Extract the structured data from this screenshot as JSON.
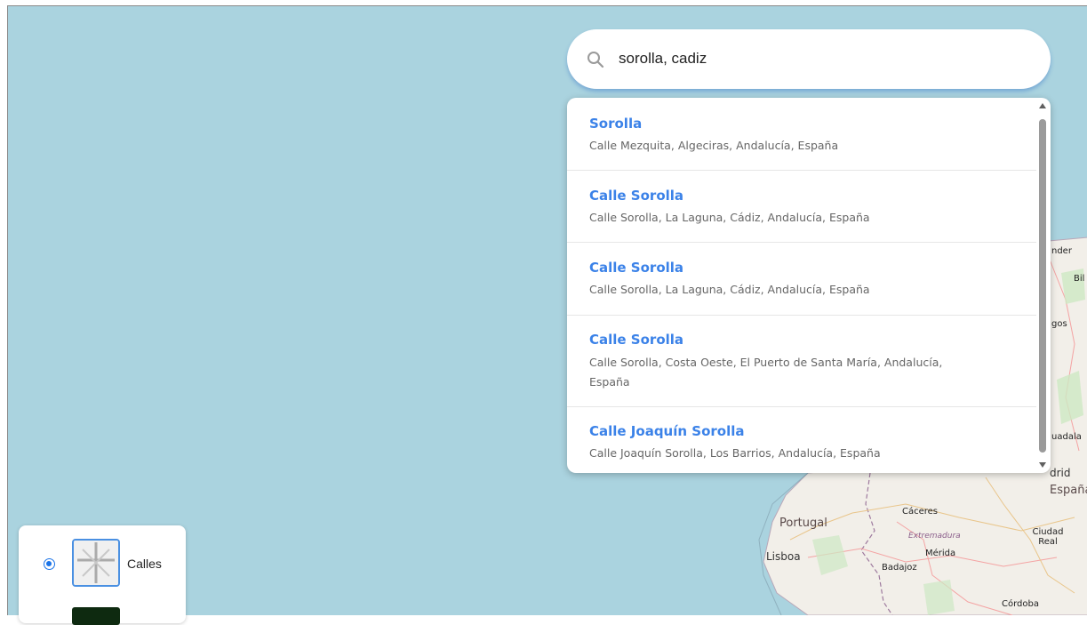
{
  "search": {
    "value": "sorolla, cadiz",
    "icon": "search-icon"
  },
  "results": [
    {
      "title": "Sorolla",
      "address": "Calle Mezquita, Algeciras, Andalucía, España"
    },
    {
      "title": "Calle Sorolla",
      "address": "Calle Sorolla, La Laguna, Cádiz, Andalucía, España"
    },
    {
      "title": "Calle Sorolla",
      "address": "Calle Sorolla, La Laguna, Cádiz, Andalucía, España"
    },
    {
      "title": "Calle Sorolla",
      "address": "Calle Sorolla, Costa Oeste, El Puerto de Santa María, Andalucía, España"
    },
    {
      "title": "Calle Joaquín Sorolla",
      "address": "Calle Joaquín Sorolla, Los Barrios, Andalucía, España"
    }
  ],
  "map": {
    "labels": {
      "portugal": "Portugal",
      "lisboa": "Lisboa",
      "caceres": "Cáceres",
      "extremadura": "Extremadura",
      "merida": "Mérida",
      "badajoz": "Badajoz",
      "ciudad_real": "Ciudad Real",
      "cordoba": "Córdoba",
      "espana": "España",
      "madrid": "drid",
      "guadalajara": "uadala",
      "santander": "nder",
      "bilbao": "Bil",
      "burgos": "gos"
    }
  },
  "layers": {
    "items": [
      {
        "label": "Calles",
        "selected": true,
        "icon": "streets-layer-icon"
      }
    ]
  },
  "colors": {
    "sea": "#aad3df",
    "land": "#f2efe9",
    "accent": "#3b82e8"
  }
}
